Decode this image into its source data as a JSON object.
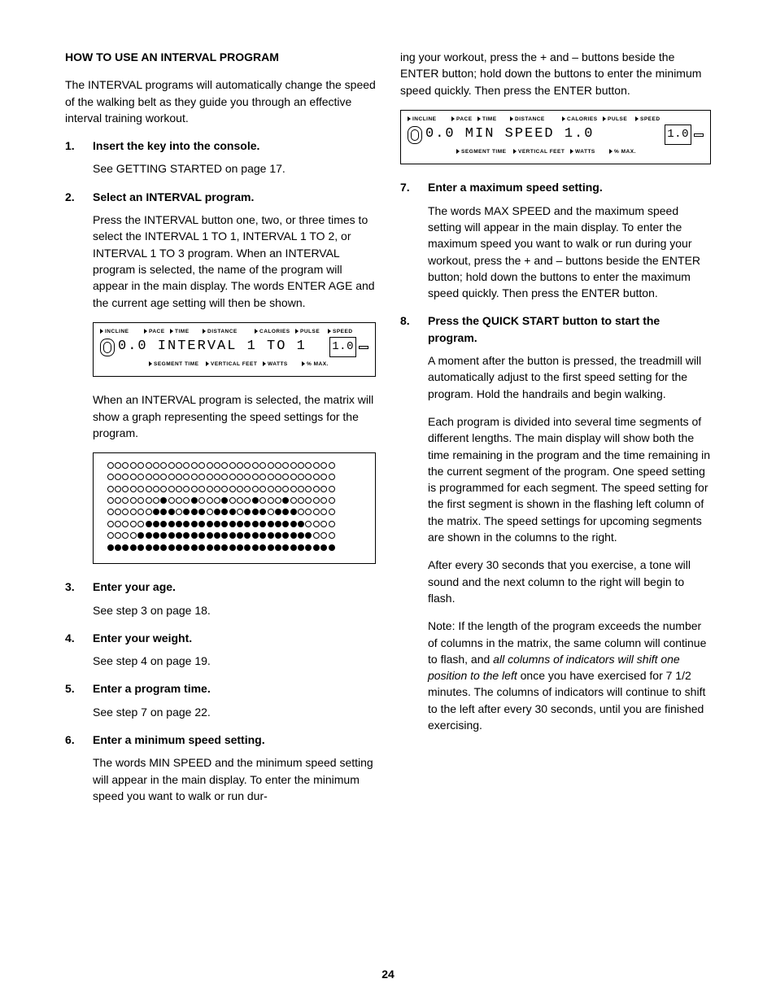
{
  "title": "HOW TO USE AN INTERVAL PROGRAM",
  "intro": "The INTERVAL programs will automatically change the speed of the walking belt as they guide you through an effective interval training workout.",
  "page_number": "24",
  "steps": {
    "s1": {
      "num": "1.",
      "head": "Insert the key into the console.",
      "body1": "See GETTING STARTED on page 17."
    },
    "s2": {
      "num": "2.",
      "head": "Select an INTERVAL program.",
      "body1": "Press the INTERVAL button one, two, or three times to select the INTERVAL 1 TO 1, INTERVAL 1 TO 2, or INTERVAL 1 TO 3 program. When an INTERVAL program is selected, the name of the program will appear in the main display. The words ENTER AGE and the current age setting will then be shown.",
      "body2": "When an INTERVAL program is selected, the matrix will show a graph representing the speed settings for the program."
    },
    "s3": {
      "num": "3.",
      "head": "Enter your age.",
      "body1": "See step 3 on page 18."
    },
    "s4": {
      "num": "4.",
      "head": "Enter your weight.",
      "body1": "See step 4 on page 19."
    },
    "s5": {
      "num": "5.",
      "head": "Enter a program time.",
      "body1": "See step 7 on page 22."
    },
    "s6": {
      "num": "6.",
      "head": "Enter a minimum speed setting.",
      "body1": "The words MIN SPEED and the minimum speed setting will appear in the main display. To enter the minimum speed you want to walk or run dur-",
      "cont": "ing your workout, press the + and – buttons beside the ENTER button; hold down the buttons to enter the minimum speed quickly. Then press the ENTER button."
    },
    "s7": {
      "num": "7.",
      "head": "Enter a maximum speed setting.",
      "body1": "The words MAX SPEED and the maximum speed setting will appear in the main display. To enter the maximum speed you want to walk or run during your workout, press the + and – buttons beside the ENTER button; hold down the buttons to enter the maximum speed quickly. Then press the ENTER button."
    },
    "s8": {
      "num": "8.",
      "head": "Press the QUICK START button to start the program.",
      "body1": "A moment after the button is pressed, the treadmill will automatically adjust to the first speed setting for the program. Hold the handrails and begin walking.",
      "body2": "Each program is divided into several time segments of different lengths. The main display will show both the time remaining in the program and the time remaining in the current segment of the program. One speed setting is programmed for each segment. The speed setting for the first segment is shown in the flashing left column of the matrix. The speed settings for upcoming segments are shown in the columns to the right.",
      "body3": "After every 30 seconds that you exercise, a tone will sound and the next column to the right will begin to flash.",
      "body4a": "Note: If the length of the program exceeds the number of columns in the matrix, the same column will continue to flash, and ",
      "body4i": "all columns of indicators will shift one position to the left",
      "body4b": " once you have exercised for 7 1/2 minutes. The columns of indicators will continue to shift to the left after every 30 seconds, until you are finished exercising."
    }
  },
  "panel_labels": {
    "top": {
      "incline": "INCLINE",
      "pace": "PACE",
      "time": "TIME",
      "distance": "DISTANCE",
      "calories": "CALORIES",
      "pulse": "PULSE",
      "speed": "SPEED"
    },
    "bottom": {
      "segment_time": "SEGMENT TIME",
      "vertical_feet": "VERTICAL FEET",
      "watts": "WATTS",
      "pct_max": "% MAX."
    }
  },
  "panel1": {
    "lcd": "0.0 INTERVAL 1 TO 1",
    "box": "1.0"
  },
  "panel2": {
    "lcd": "0.0 MIN SPEED 1.0",
    "box": "1.0"
  },
  "chart_data": {
    "type": "heatmap",
    "title": "Interval program speed profile matrix",
    "rows": 8,
    "cols": 30,
    "filled": [
      "000000000000000000000000000000",
      "000000000000000000000000000000",
      "000000000000000000000000000000",
      "000000010001000100010001000000",
      "000000111011101110111011100000",
      "000001111111111111111111110000",
      "000011111111111111111111111000",
      "111111111111111111111111111111"
    ]
  }
}
